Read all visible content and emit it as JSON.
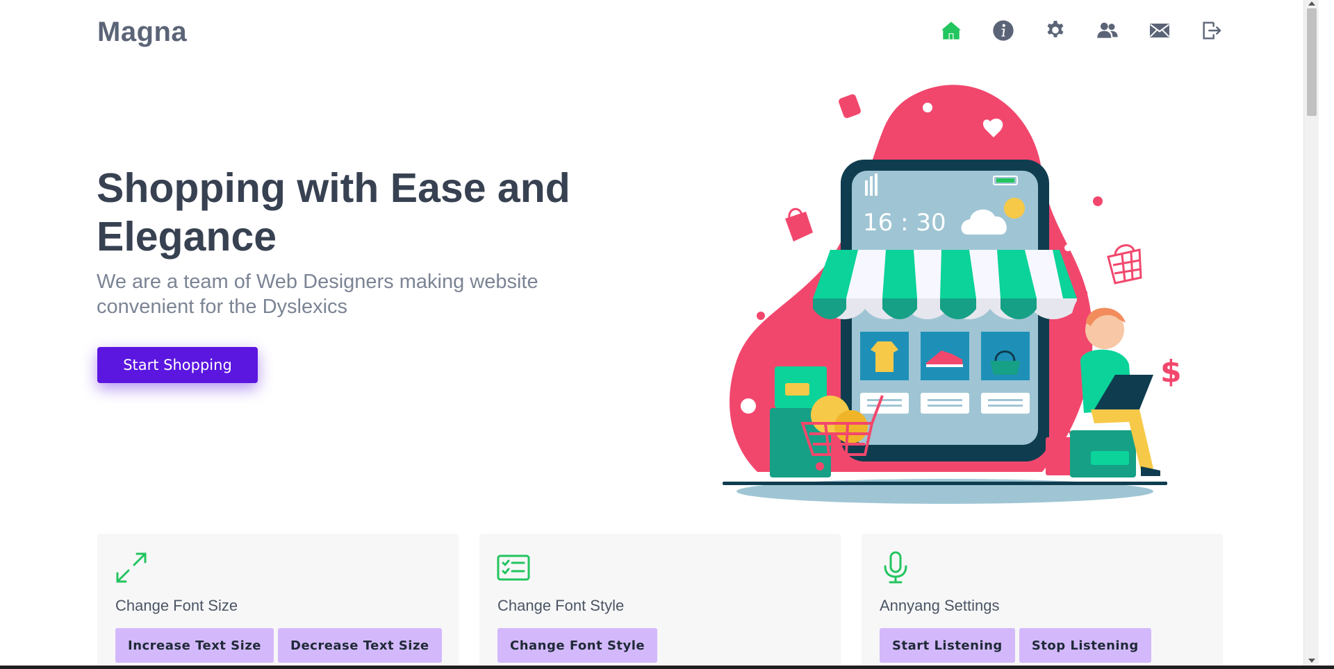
{
  "brand": {
    "name": "Magna"
  },
  "nav": {
    "items": [
      {
        "icon": "home-icon",
        "active": true
      },
      {
        "icon": "info-icon",
        "active": false
      },
      {
        "icon": "gear-icon",
        "active": false
      },
      {
        "icon": "users-icon",
        "active": false
      },
      {
        "icon": "mail-icon",
        "active": false
      },
      {
        "icon": "logout-icon",
        "active": false
      }
    ],
    "active_color": "#22c55e",
    "icon_color": "#5b6477"
  },
  "hero": {
    "title": "Shopping with Ease and Elegance",
    "subtitle": "We are a team of Web Designers making website convenient for the Dyslexics",
    "cta_label": "Start Shopping",
    "illustration": {
      "icon": "online-store-illustration",
      "phone_time": "16 : 30"
    }
  },
  "features": [
    {
      "icon": "expand-arrows-icon",
      "title": "Change Font Size",
      "buttons": [
        "Increase Text Size",
        "Decrease Text Size"
      ]
    },
    {
      "icon": "checklist-icon",
      "title": "Change Font Style",
      "buttons": [
        "Change Font Style"
      ]
    },
    {
      "icon": "microphone-icon",
      "title": "Annyang Settings",
      "buttons": [
        "Start Listening",
        "Stop Listening"
      ]
    }
  ],
  "colors": {
    "accent": "#5b16e0",
    "pill": "#d3b9fb",
    "feature_icon": "#22c55e",
    "card_bg": "#f7f7f8"
  }
}
